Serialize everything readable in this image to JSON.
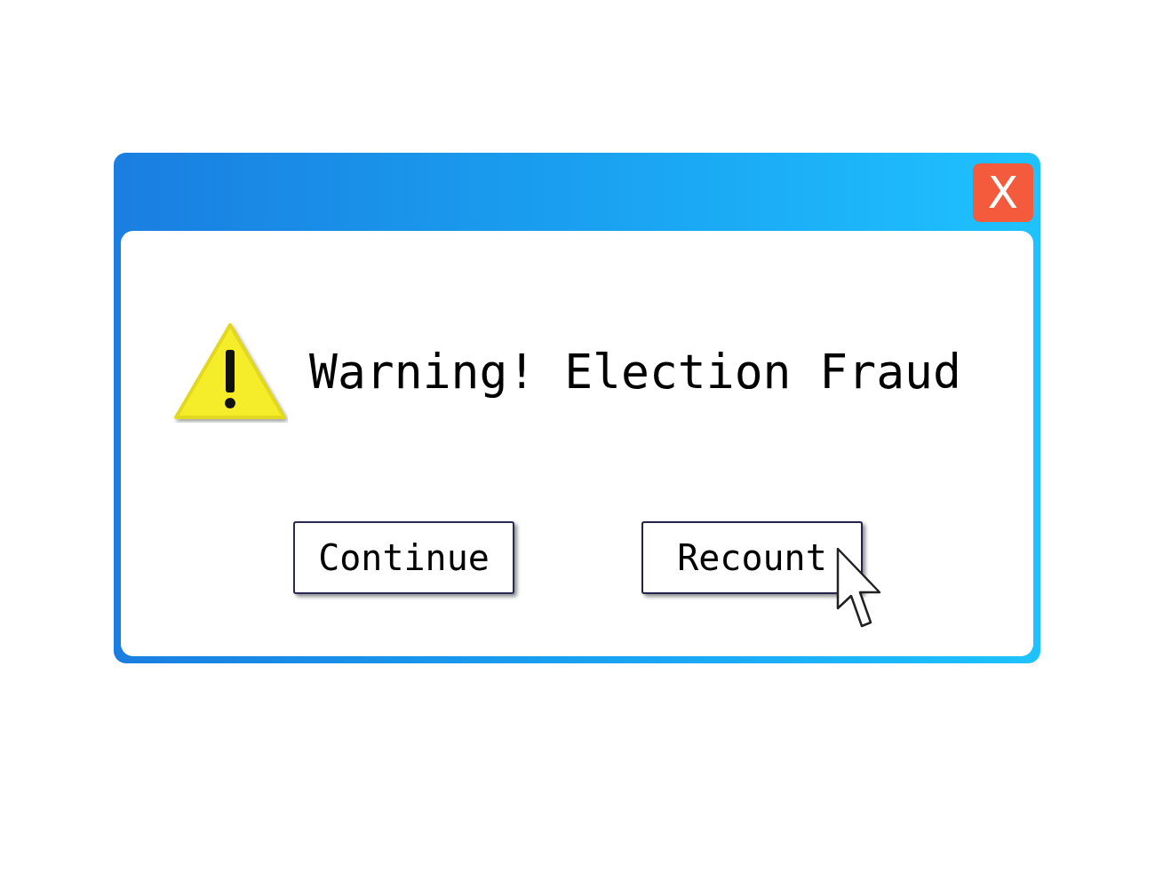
{
  "dialog": {
    "close_button": "X",
    "message": "Warning! Election Fraud",
    "buttons": [
      {
        "label": "Continue",
        "hovered": false
      },
      {
        "label": "Recount",
        "hovered": true
      }
    ]
  }
}
